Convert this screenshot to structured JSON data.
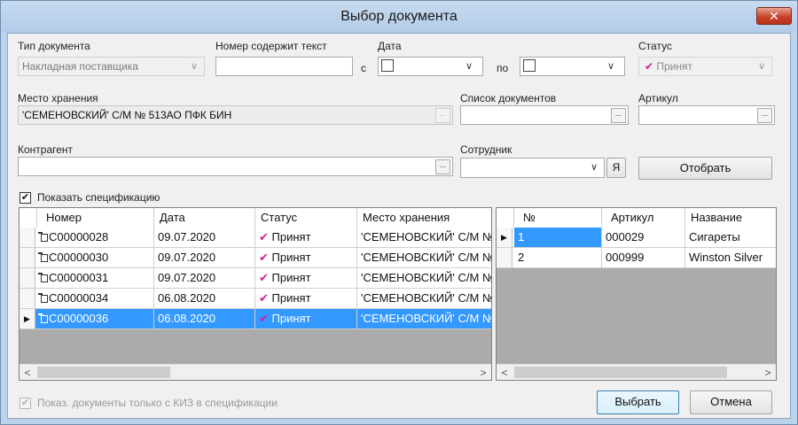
{
  "window": {
    "title": "Выбор документа",
    "close_glyph": "✕"
  },
  "filters": {
    "doc_type": {
      "label": "Тип документа",
      "value": "Накладная поставщика"
    },
    "number": {
      "label": "Номер содержит текст",
      "value": ""
    },
    "date": {
      "label": "Дата",
      "from_label": "с",
      "to_label": "по"
    },
    "status": {
      "label": "Статус",
      "value": "Принят"
    },
    "storage": {
      "label": "Место хранения",
      "value": "'СЕМЕНОВСКИЙ' С/М № 513АО ПФК БИН"
    },
    "doc_list": {
      "label": "Список документов",
      "value": ""
    },
    "article": {
      "label": "Артикул",
      "value": ""
    },
    "counterparty": {
      "label": "Контрагент",
      "value": ""
    },
    "employee": {
      "label": "Сотрудник",
      "value": "",
      "ya_button": "Я"
    },
    "ellipsis": "...",
    "chevron": "∨"
  },
  "actions": {
    "filter_button": "Отобрать",
    "select_button": "Выбрать",
    "cancel_button": "Отмена"
  },
  "show_spec": {
    "label": "Показать спецификацию",
    "checked": true,
    "mark": "✔"
  },
  "kiz_only": {
    "label": "Показ. документы только с КИЗ в спецификации",
    "checked": true,
    "mark": "✔"
  },
  "docs_grid": {
    "columns": [
      "Номер",
      "Дата",
      "Статус",
      "Место хранения"
    ],
    "status_tick": "✔",
    "row_pointer": "▶",
    "rows": [
      {
        "number": "C00000028",
        "date": "09.07.2020",
        "status": "Принят",
        "storage": "'СЕМЕНОВСКИЙ' С/М №"
      },
      {
        "number": "C00000030",
        "date": "09.07.2020",
        "status": "Принят",
        "storage": "'СЕМЕНОВСКИЙ' С/М №"
      },
      {
        "number": "C00000031",
        "date": "09.07.2020",
        "status": "Принят",
        "storage": "'СЕМЕНОВСКИЙ' С/М №"
      },
      {
        "number": "C00000034",
        "date": "06.08.2020",
        "status": "Принят",
        "storage": "'СЕМЕНОВСКИЙ' С/М №"
      },
      {
        "number": "C00000036",
        "date": "06.08.2020",
        "status": "Принят",
        "storage": "'СЕМЕНОВСКИЙ' С/М №"
      }
    ],
    "selected_index": 4,
    "scroll_left": "<",
    "scroll_right": ">"
  },
  "spec_grid": {
    "columns": [
      "№",
      "Артикул",
      "Название"
    ],
    "row_pointer": "▶",
    "rows": [
      {
        "no": "1",
        "article": "000029",
        "name": "Сигареты"
      },
      {
        "no": "2",
        "article": "000999",
        "name": "Winston Silver"
      }
    ],
    "current_index": 0,
    "scroll_left": "<",
    "scroll_right": ">"
  },
  "colors": {
    "selection": "#3399ff",
    "status_tick": "#d41d94",
    "title_bar": "#bcd3ec",
    "close_button": "#c9422a"
  }
}
